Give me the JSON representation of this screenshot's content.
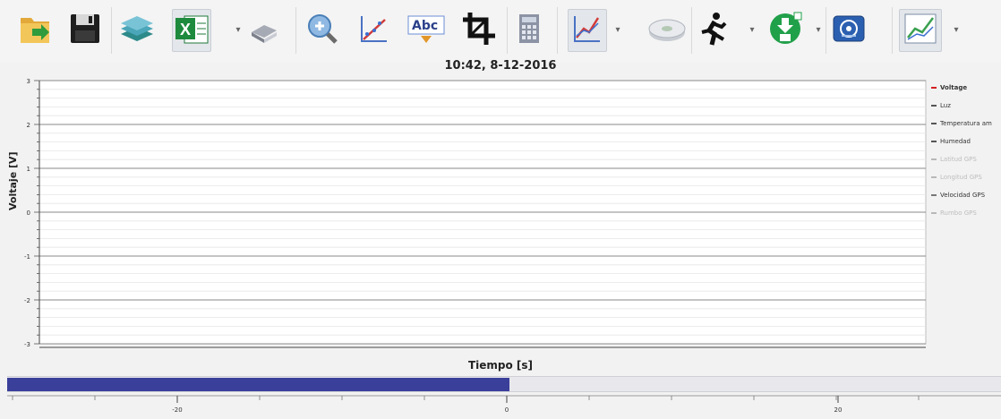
{
  "toolbar": {
    "buttons": [
      {
        "name": "open-folder-icon"
      },
      {
        "name": "save-icon"
      },
      {
        "name": "stack-icon"
      },
      {
        "name": "excel-export-icon",
        "dropdown": true
      },
      {
        "name": "eraser-icon"
      },
      {
        "name": "zoom-in-icon"
      },
      {
        "name": "fit-curve-icon"
      },
      {
        "name": "text-label-icon",
        "text": "Abc"
      },
      {
        "name": "crop-icon"
      },
      {
        "name": "calculator-icon"
      },
      {
        "name": "graph-style-icon",
        "dropdown": true
      },
      {
        "name": "disc-icon"
      },
      {
        "name": "run-icon",
        "dropdown": true
      },
      {
        "name": "download-device-icon",
        "dropdown": true
      },
      {
        "name": "settings-panel-icon"
      },
      {
        "name": "line-graph-icon",
        "dropdown": true
      }
    ]
  },
  "chart_data": {
    "type": "line",
    "title": "10:42, 8-12-2016",
    "xlabel": "Tiempo [s]",
    "ylabel": "Voltaje [V]",
    "ylim": [
      -3,
      3
    ],
    "yticks": [
      "3",
      "2",
      "1",
      "0",
      "-1",
      "-2",
      "-3"
    ],
    "grid": true,
    "legend_position": "right",
    "series": [
      {
        "name": "Voltage",
        "color": "#d42020",
        "enabled": true
      },
      {
        "name": "Luz",
        "color": "#555555",
        "enabled": true
      },
      {
        "name": "Temperatura am",
        "color": "#555555",
        "enabled": true
      },
      {
        "name": "Humedad",
        "color": "#555555",
        "enabled": true
      },
      {
        "name": "Latitud GPS",
        "color": "#b8b8b8",
        "enabled": false
      },
      {
        "name": "Longitud GPS",
        "color": "#b8b8b8",
        "enabled": false
      },
      {
        "name": "Velocidad GPS",
        "color": "#777777",
        "enabled": true
      },
      {
        "name": "Rumbo GPS",
        "color": "#b8b8b8",
        "enabled": false
      }
    ]
  },
  "range": {
    "fill_fraction": 0.505,
    "ticks": [
      "-20",
      "0",
      "20"
    ]
  }
}
